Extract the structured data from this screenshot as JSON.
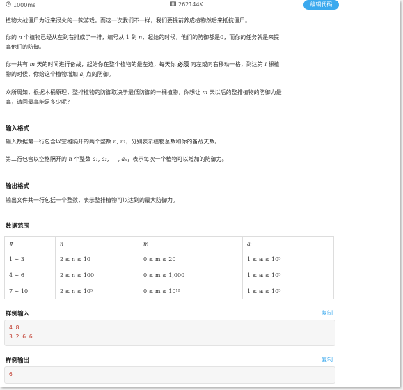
{
  "header": {
    "time_limit": "1000ms",
    "memory_limit": "262144K",
    "edit_button": "编辑代码"
  },
  "statement": {
    "p1": "植物大战僵尸为近来很火的一款游戏。而这一次我们不一样，我们要提前养成植物然后来抵抗僵尸。",
    "p2_a": "你的",
    "p2_n": "n",
    "p2_b": "个植物已经从左到右排成了一排，编号从",
    "p2_one": "1",
    "p2_c": "到",
    "p2_n2": "n",
    "p2_d": "，起始的时候，他们的防御都是",
    "p2_zero": "0",
    "p2_e": "，而你的任务就是来提",
    "p2_f": "高他们的防御。",
    "p3_a": "你一共有",
    "p3_m": "m",
    "p3_b": "天的时间进行备战，起始你在整个植物的最左边，每天你",
    "p3_must": "必须",
    "p3_c": "向左或向右移动一格，到达第",
    "p3_i": "i",
    "p3_d": "棵植",
    "p3_e": "物的时候，你给这个植物增加",
    "p3_ai": "a",
    "p3_ai_sub": "i",
    "p3_f": "点的防御。",
    "p4_a": "众所周知，根据木桶原理，整排植物的防御取决于最低防御的一棵植物，你想让",
    "p4_m": "m",
    "p4_b": "天以后的整排植物的防御力最",
    "p4_c": "高，请问最高能是多少呢？"
  },
  "input_format": {
    "title": "输入格式",
    "l1_a": "输入数据第一行包含以空格隔开的两个整数",
    "l1_nm": "n, m",
    "l1_b": "，分别表示植物总数和你的备战天数。",
    "l2_a": "第二行包含以空格隔开的",
    "l2_n": "n",
    "l2_b": "个整数",
    "l2_seq": "a₁, a₂, ⋯ , aₙ",
    "l2_c": "，表示每次一个植物可以增加的防御力。"
  },
  "output_format": {
    "title": "输出格式",
    "l1": "输出文件共一行包括一个整数，表示整排植物可以达到的最大防御力。"
  },
  "range": {
    "title": "数据范围",
    "headers": [
      "#",
      "n",
      "m",
      "aᵢ"
    ],
    "rows": [
      [
        "1 ∼ 3",
        "2 ≤ n ≤ 10",
        "0 ≤ m ≤ 20",
        "1 ≤ aᵢ ≤ 10⁵"
      ],
      [
        "4 ∼ 6",
        "2 ≤ n ≤ 100",
        "0 ≤ m ≤ 1,000",
        "1 ≤ aᵢ ≤ 10⁵"
      ],
      [
        "7 ∼ 10",
        "2 ≤ n ≤ 10⁵",
        "0 ≤ m ≤ 10¹²",
        "1 ≤ aᵢ ≤ 10⁵"
      ]
    ]
  },
  "sample_input": {
    "title": "样例输入",
    "copy": "复制",
    "lines": [
      "4 8",
      "3 2 6 6"
    ]
  },
  "sample_output": {
    "title": "样例输出",
    "copy": "复制",
    "lines": [
      "6"
    ]
  },
  "colors": {
    "accent": "#3ba9ee",
    "code_text": "#c0392b"
  }
}
